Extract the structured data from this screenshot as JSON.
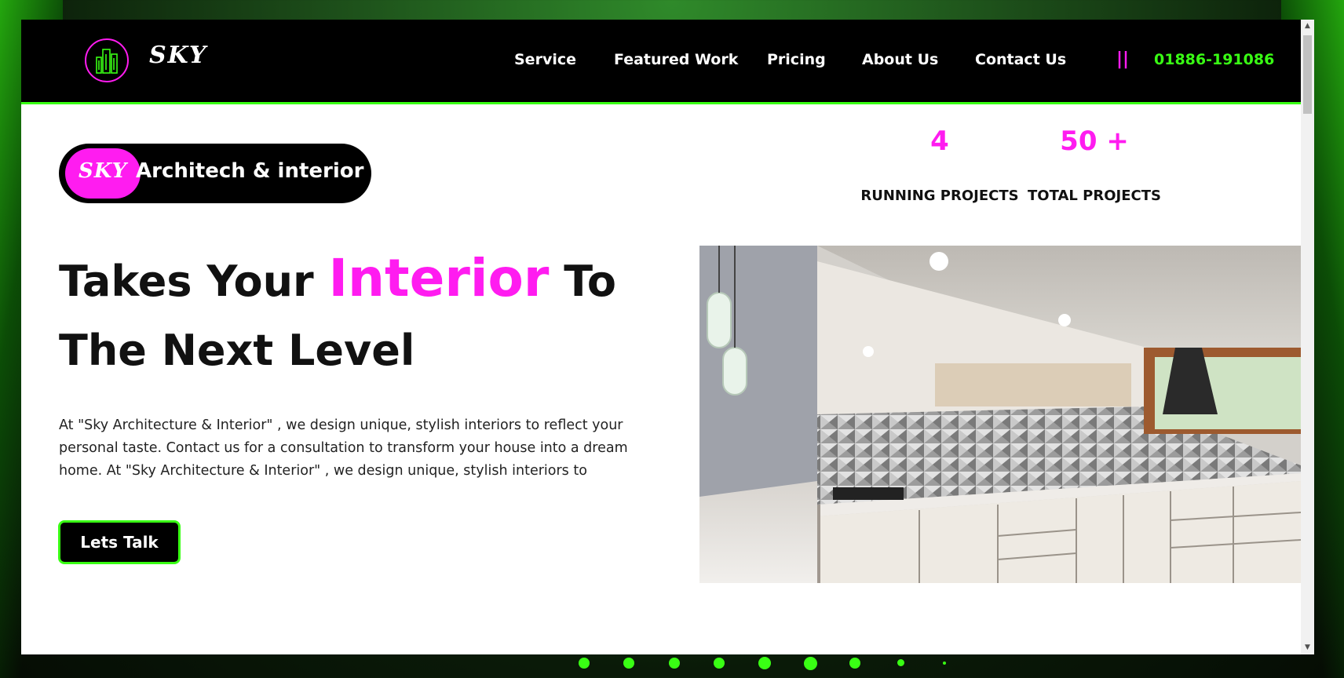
{
  "brand": {
    "logo_text": "SKY",
    "icon": "building-logo-icon"
  },
  "nav": {
    "items": [
      {
        "label": "Service"
      },
      {
        "label": "Featured Work"
      },
      {
        "label": "Pricing"
      },
      {
        "label": "About Us"
      },
      {
        "label": "Contact Us"
      }
    ],
    "separator": "||",
    "phone": "01886-191086"
  },
  "hero": {
    "badge": {
      "logo": "SKY",
      "text": "Architech & interior"
    },
    "headline_part1": "Takes Your",
    "headline_accent": "Interior",
    "headline_part2": "To",
    "headline_line2": "The Next Level",
    "body": "At \"Sky Architecture & Interior\" , we design unique, stylish interiors to reflect your personal taste. Contact us for a consultation to transform your house into a dream home. At \"Sky Architecture & Interior\" , we design unique, stylish interiors to",
    "cta_label": "Lets Talk"
  },
  "stats": [
    {
      "value": "4",
      "label": "RUNNING PROJECTS"
    },
    {
      "value": "50 +",
      "label": "TOTAL PROJECTS"
    }
  ],
  "colors": {
    "accent": "#ff1cf0",
    "green": "#39ff14",
    "nav_bg": "#000000"
  }
}
